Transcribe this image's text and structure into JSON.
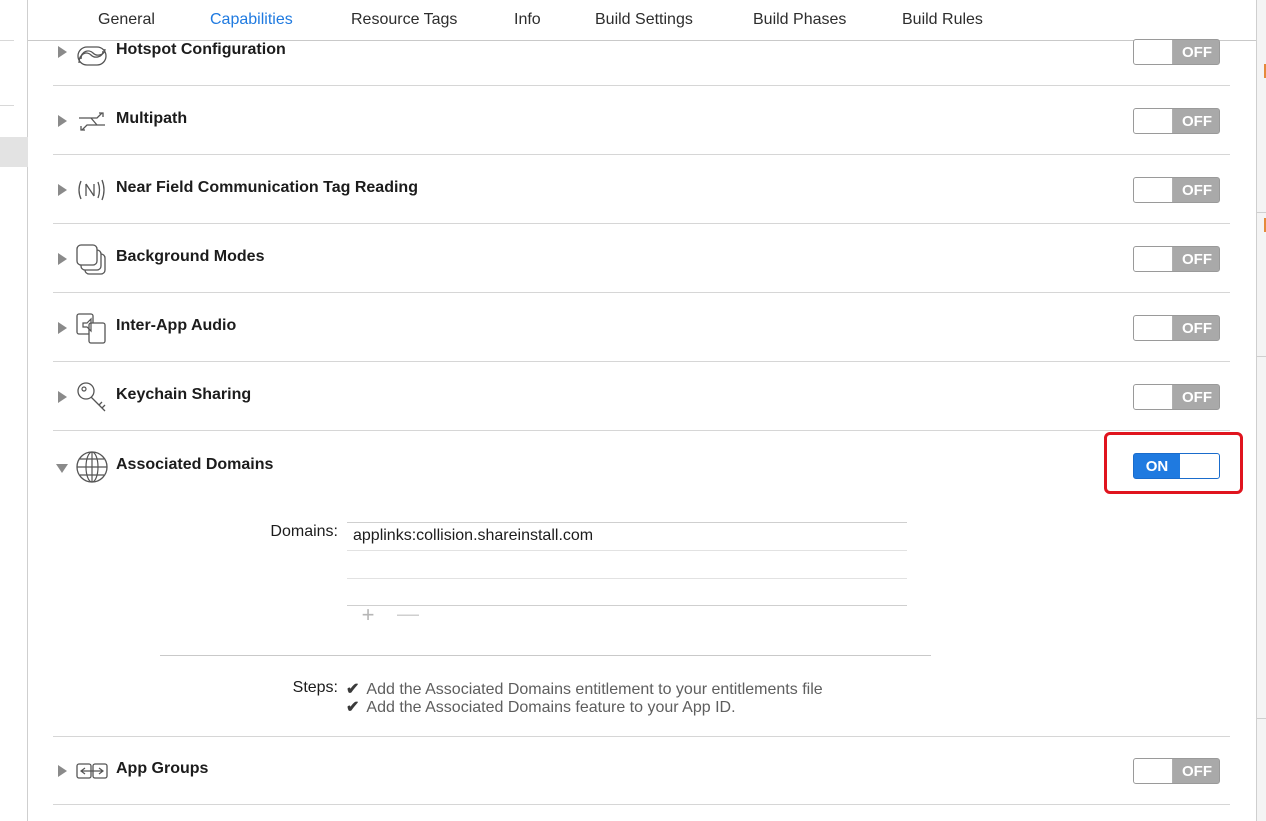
{
  "tabs": [
    {
      "label": "General",
      "active": false
    },
    {
      "label": "Capabilities",
      "active": true
    },
    {
      "label": "Resource Tags",
      "active": false
    },
    {
      "label": "Info",
      "active": false
    },
    {
      "label": "Build Settings",
      "active": false
    },
    {
      "label": "Build Phases",
      "active": false
    },
    {
      "label": "Build Rules",
      "active": false
    }
  ],
  "capabilities": [
    {
      "title": "Hotspot Configuration",
      "icon": "hotspot-icon",
      "state": "OFF",
      "expanded": false
    },
    {
      "title": "Multipath",
      "icon": "multipath-icon",
      "state": "OFF",
      "expanded": false
    },
    {
      "title": "Near Field Communication Tag Reading",
      "icon": "nfc-icon",
      "state": "OFF",
      "expanded": false
    },
    {
      "title": "Background Modes",
      "icon": "background-modes-icon",
      "state": "OFF",
      "expanded": false
    },
    {
      "title": "Inter-App Audio",
      "icon": "inter-app-audio-icon",
      "state": "OFF",
      "expanded": false
    },
    {
      "title": "Keychain Sharing",
      "icon": "keychain-icon",
      "state": "OFF",
      "expanded": false
    },
    {
      "title": "Associated Domains",
      "icon": "globe-icon",
      "state": "ON",
      "expanded": true
    },
    {
      "title": "App Groups",
      "icon": "app-groups-icon",
      "state": "OFF",
      "expanded": false
    }
  ],
  "associated_domains": {
    "domains_label": "Domains:",
    "domains": [
      "applinks:collision.shareinstall.com",
      "",
      ""
    ],
    "add_label": "+",
    "remove_label": "—",
    "steps_label": "Steps:",
    "steps": [
      {
        "check": "✔",
        "text": "Add the Associated Domains entitlement to your entitlements file"
      },
      {
        "check": "✔",
        "text": "Add the Associated Domains feature to your App ID."
      }
    ]
  },
  "colors": {
    "accent": "#1f7ae0",
    "highlight": "#e0141e",
    "toggle_off": "#a9a9a9"
  }
}
